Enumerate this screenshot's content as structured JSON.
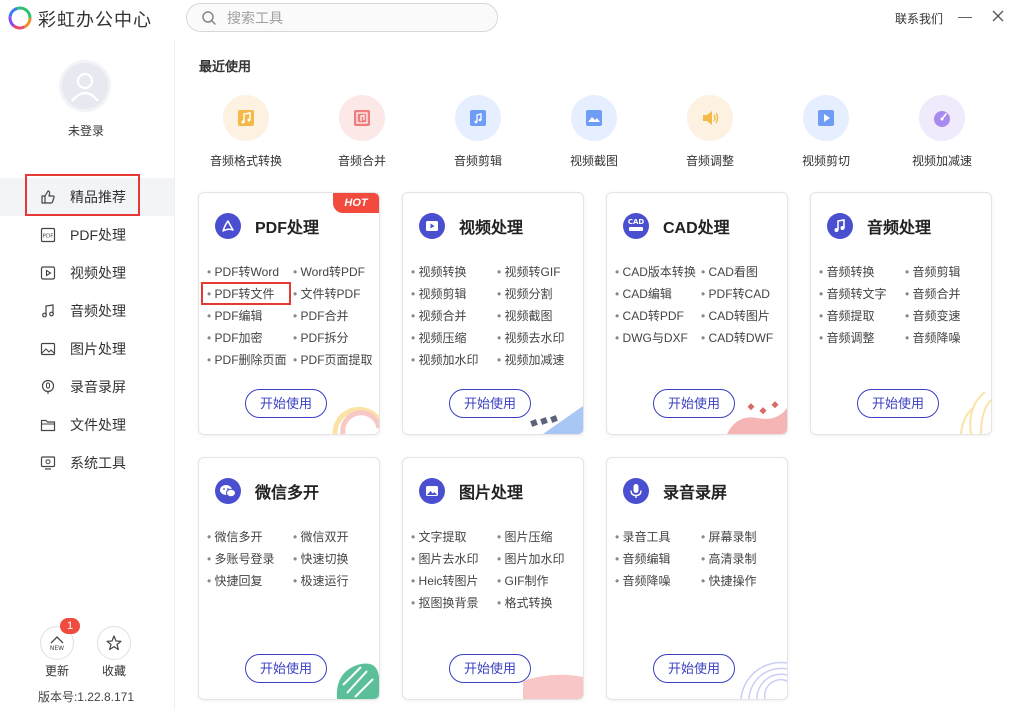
{
  "app": {
    "title": "彩虹办公中心"
  },
  "search": {
    "placeholder": "搜索工具"
  },
  "header": {
    "contact": "联系我们",
    "minimize": "—"
  },
  "user": {
    "status": "未登录"
  },
  "sidebar": {
    "items": [
      {
        "label": "精品推荐",
        "icon": "thumbs-up-icon"
      },
      {
        "label": "PDF处理",
        "icon": "pdf-icon"
      },
      {
        "label": "视频处理",
        "icon": "video-icon"
      },
      {
        "label": "音频处理",
        "icon": "music-note-icon"
      },
      {
        "label": "图片处理",
        "icon": "image-icon"
      },
      {
        "label": "录音录屏",
        "icon": "record-icon"
      },
      {
        "label": "文件处理",
        "icon": "folder-icon"
      },
      {
        "label": "系统工具",
        "icon": "monitor-icon"
      }
    ],
    "update_label": "更新",
    "update_badge": "1",
    "update_icon_text": "NEW",
    "favorite_label": "收藏",
    "version": "版本号:1.22.8.171"
  },
  "recent": {
    "title": "最近使用",
    "items": [
      {
        "label": "音频格式转换",
        "color": "#fdf1e2"
      },
      {
        "label": "音频合并",
        "color": "#fde8e8"
      },
      {
        "label": "音频剪辑",
        "color": "#e6efff"
      },
      {
        "label": "视频截图",
        "color": "#e6efff"
      },
      {
        "label": "音频调整",
        "color": "#fdf1e2"
      },
      {
        "label": "视频剪切",
        "color": "#e6efff"
      },
      {
        "label": "视频加减速",
        "color": "#efeafc"
      }
    ]
  },
  "cards": [
    {
      "title": "PDF处理",
      "hot": "HOT",
      "button": "开始使用",
      "links": [
        "PDF转Word",
        "Word转PDF",
        "PDF转文件",
        "文件转PDF",
        "PDF编辑",
        "PDF合并",
        "PDF加密",
        "PDF拆分",
        "PDF删除页面",
        "PDF页面提取"
      ]
    },
    {
      "title": "视频处理",
      "button": "开始使用",
      "links": [
        "视频转换",
        "视频转GIF",
        "视频剪辑",
        "视频分割",
        "视频合并",
        "视频截图",
        "视频压缩",
        "视频去水印",
        "视频加水印",
        "视频加减速"
      ]
    },
    {
      "title": "CAD处理",
      "icon_text": "CAD",
      "button": "开始使用",
      "links": [
        "CAD版本转换",
        "CAD看图",
        "CAD编辑",
        "PDF转CAD",
        "CAD转PDF",
        "CAD转图片",
        "DWG与DXF",
        "CAD转DWF"
      ]
    },
    {
      "title": "音频处理",
      "button": "开始使用",
      "links": [
        "音频转换",
        "音频剪辑",
        "音频转文字",
        "音频合并",
        "音频提取",
        "音频变速",
        "音频调整",
        "音频降噪"
      ]
    },
    {
      "title": "微信多开",
      "button": "开始使用",
      "links": [
        "微信多开",
        "微信双开",
        "多账号登录",
        "快速切换",
        "快捷回复",
        "极速运行"
      ]
    },
    {
      "title": "图片处理",
      "button": "开始使用",
      "links": [
        "文字提取",
        "图片压缩",
        "图片去水印",
        "图片加水印",
        "Heic转图片",
        "GIF制作",
        "抠图换背景",
        "格式转换"
      ]
    },
    {
      "title": "录音录屏",
      "button": "开始使用",
      "links": [
        "录音工具",
        "屏幕录制",
        "音频编辑",
        "高清录制",
        "音频降噪",
        "快捷操作"
      ]
    }
  ],
  "colors": {
    "accent": "#3b40c2",
    "hot": "#f24a3c",
    "highlight": "#e53935"
  }
}
